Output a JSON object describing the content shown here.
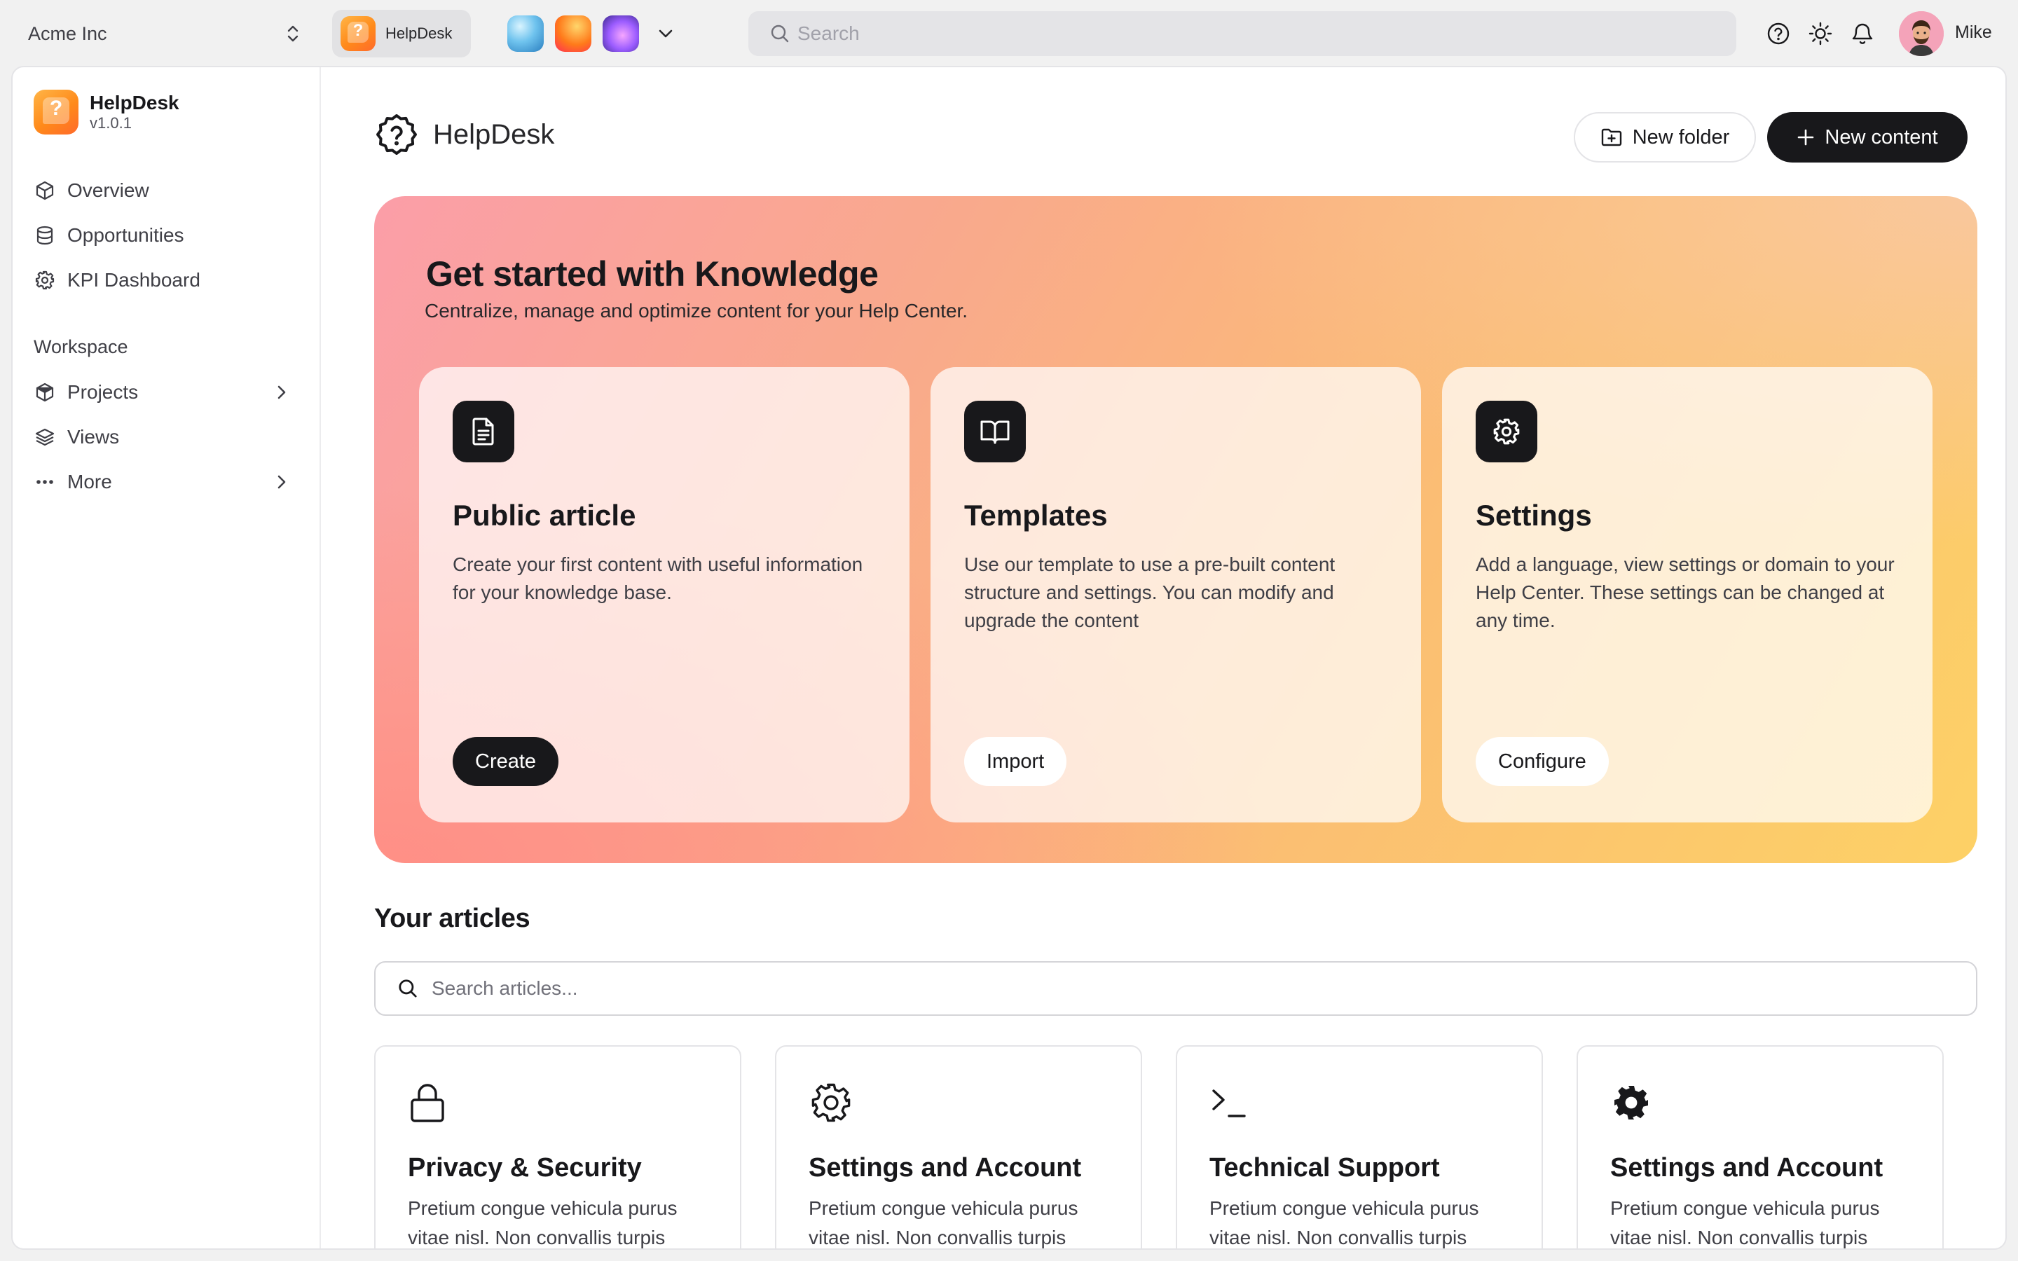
{
  "topbar": {
    "org_name": "Acme Inc",
    "active_app": "HelpDesk",
    "search_placeholder": "Search",
    "user_name": "Mike"
  },
  "sidebar": {
    "brand_name": "HelpDesk",
    "brand_version": "v1.0.1",
    "items": [
      {
        "label": "Overview",
        "icon": "cube-outline-icon"
      },
      {
        "label": "Opportunities",
        "icon": "database-icon"
      },
      {
        "label": "KPI Dashboard",
        "icon": "gear-icon"
      }
    ],
    "workspace_label": "Workspace",
    "workspace_items": [
      {
        "label": "Projects",
        "icon": "box-icon",
        "has_children": true
      },
      {
        "label": "Views",
        "icon": "layers-icon",
        "has_children": false
      },
      {
        "label": "More",
        "icon": "ellipsis-icon",
        "has_children": true
      }
    ]
  },
  "main": {
    "title": "HelpDesk",
    "new_folder_label": "New folder",
    "new_content_label": "New content",
    "hero": {
      "title": "Get started with Knowledge",
      "subtitle": "Centralize, manage and optimize content for your Help Center.",
      "cards": [
        {
          "title": "Public article",
          "description": "Create your first content with useful information for your knowledge base.",
          "action": "Create",
          "icon": "document-icon"
        },
        {
          "title": "Templates",
          "description": "Use our template to use a pre-built content structure and settings. You can modify and upgrade the content",
          "action": "Import",
          "icon": "book-icon"
        },
        {
          "title": "Settings",
          "description": "Add a language, view settings or domain to your Help Center. These settings can be changed at any time.",
          "action": "Configure",
          "icon": "gear-icon"
        }
      ]
    },
    "articles_title": "Your articles",
    "articles_search_placeholder": "Search articles...",
    "articles": [
      {
        "title": "Privacy & Security",
        "description": "Pretium congue vehicula purus vitae nisl. Non convallis turpis",
        "icon": "lock-icon"
      },
      {
        "title": "Settings and Account",
        "description": "Pretium congue vehicula purus vitae nisl. Non convallis turpis",
        "icon": "gear-outline-icon"
      },
      {
        "title": "Technical Support",
        "description": "Pretium congue vehicula purus vitae nisl. Non convallis turpis",
        "icon": "terminal-icon"
      },
      {
        "title": "Settings and Account",
        "description": "Pretium congue vehicula purus vitae nisl. Non convallis turpis",
        "icon": "gear-filled-icon"
      }
    ]
  },
  "colors": {
    "dark": "#18181b",
    "hero_pink": "#fb9ea8",
    "hero_yellow": "#fdd166",
    "app_orange": "#ff8a1a"
  }
}
